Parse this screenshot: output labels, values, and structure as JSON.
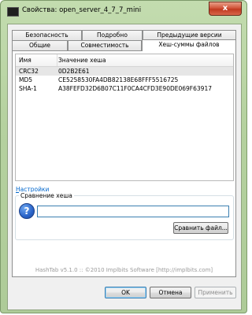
{
  "window": {
    "title": "Свойства: open_server_4_7_7_mini",
    "close_glyph": "x"
  },
  "tabs": {
    "row1": [
      "Безопасность",
      "Подробно",
      "Предыдущие версии"
    ],
    "row2": [
      "Общие",
      "Совместимость",
      "Хеш-суммы файлов"
    ],
    "active": "Хеш-суммы файлов"
  },
  "hash_list": {
    "columns": [
      "Имя",
      "Значение хеша"
    ],
    "rows": [
      {
        "name": "CRC32",
        "value": "0D2B2E61"
      },
      {
        "name": "MD5",
        "value": "CE5258530FA4DB82138E68FFF5516725"
      },
      {
        "name": "SHA-1",
        "value": "A38FEFD32D6B07C11F0CA4CFD3E90DE069F63917"
      }
    ],
    "selected_row": 0
  },
  "settings_link": "Настройки",
  "compare": {
    "legend": "Сравнение хеша",
    "input_value": "",
    "button_label": "Сравнить файл...",
    "help_glyph": "?"
  },
  "footer_text": "HashTab v5.1.0 :: ©2010 Implbits Software [http://implbits.com]",
  "buttons": {
    "ok": "OK",
    "cancel": "Отмена",
    "apply": "Применить"
  },
  "icons": {
    "app": "app-icon",
    "help": "question-icon"
  },
  "colors": {
    "window_frame": "#b5d19f",
    "link": "#0066cc",
    "close_button": "#c03a20"
  }
}
